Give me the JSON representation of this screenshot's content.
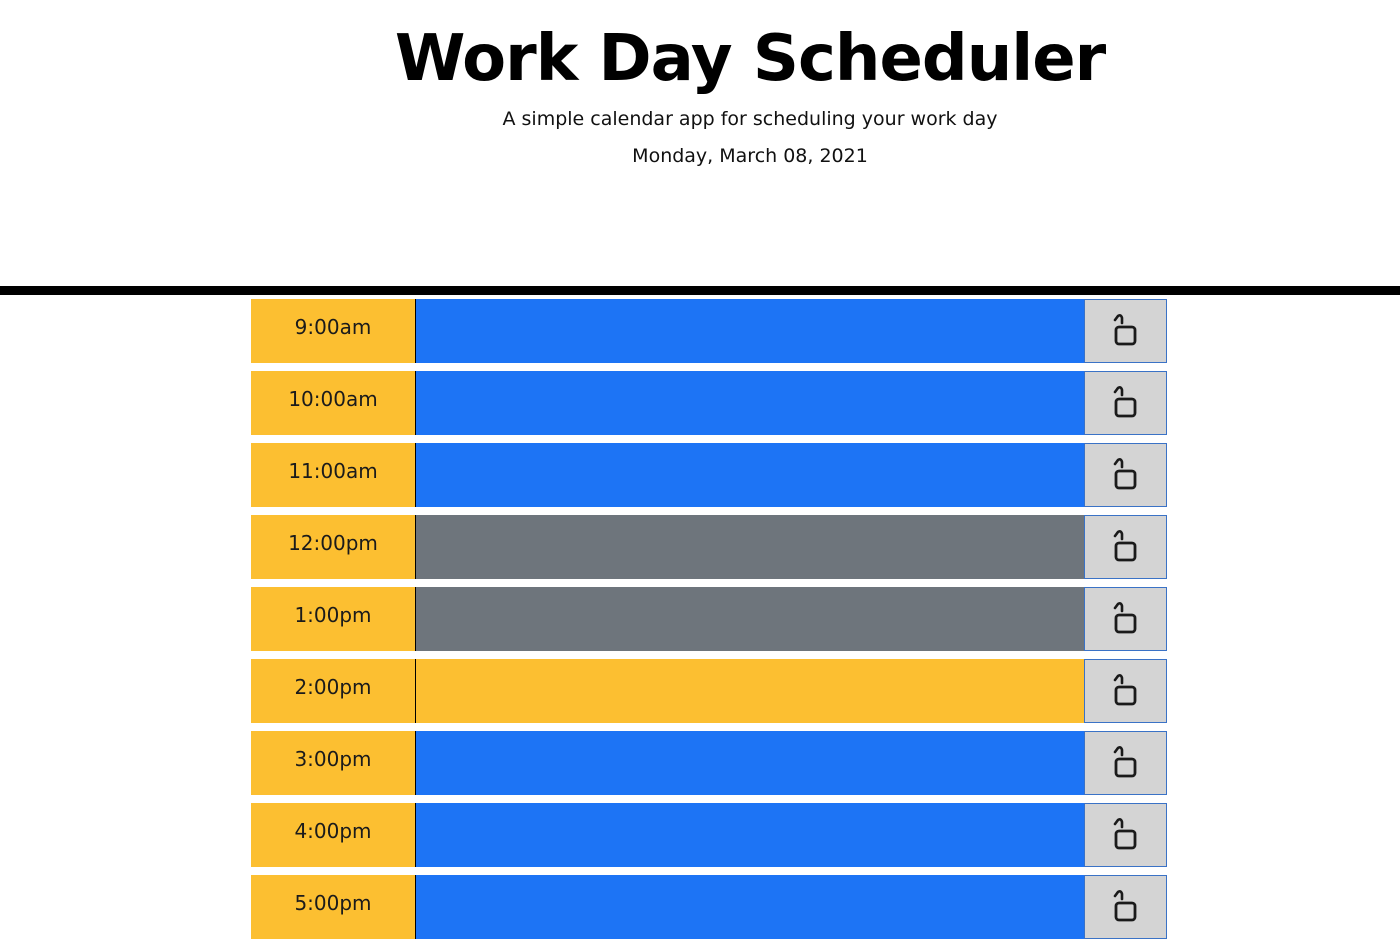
{
  "header": {
    "title": "Work Day Scheduler",
    "subtitle": "A simple calendar app for scheduling your work day",
    "date": "Monday, March 08, 2021"
  },
  "colors": {
    "hour_bg": "#fcbf31",
    "future": "#1d74f5",
    "past": "#6e757c",
    "present": "#fcbf31",
    "save_bg": "#d4d4d4"
  },
  "rows": [
    {
      "time": "9:00am",
      "status": "future",
      "text": "",
      "icon": "unlock-icon"
    },
    {
      "time": "10:00am",
      "status": "future",
      "text": "",
      "icon": "unlock-icon"
    },
    {
      "time": "11:00am",
      "status": "future",
      "text": "",
      "icon": "unlock-icon"
    },
    {
      "time": "12:00pm",
      "status": "past",
      "text": "",
      "icon": "unlock-icon"
    },
    {
      "time": "1:00pm",
      "status": "past",
      "text": "",
      "icon": "unlock-icon"
    },
    {
      "time": "2:00pm",
      "status": "present",
      "text": "",
      "icon": "unlock-icon"
    },
    {
      "time": "3:00pm",
      "status": "future",
      "text": "",
      "icon": "unlock-icon"
    },
    {
      "time": "4:00pm",
      "status": "future",
      "text": "",
      "icon": "unlock-icon"
    },
    {
      "time": "5:00pm",
      "status": "future",
      "text": "",
      "icon": "unlock-icon"
    }
  ]
}
